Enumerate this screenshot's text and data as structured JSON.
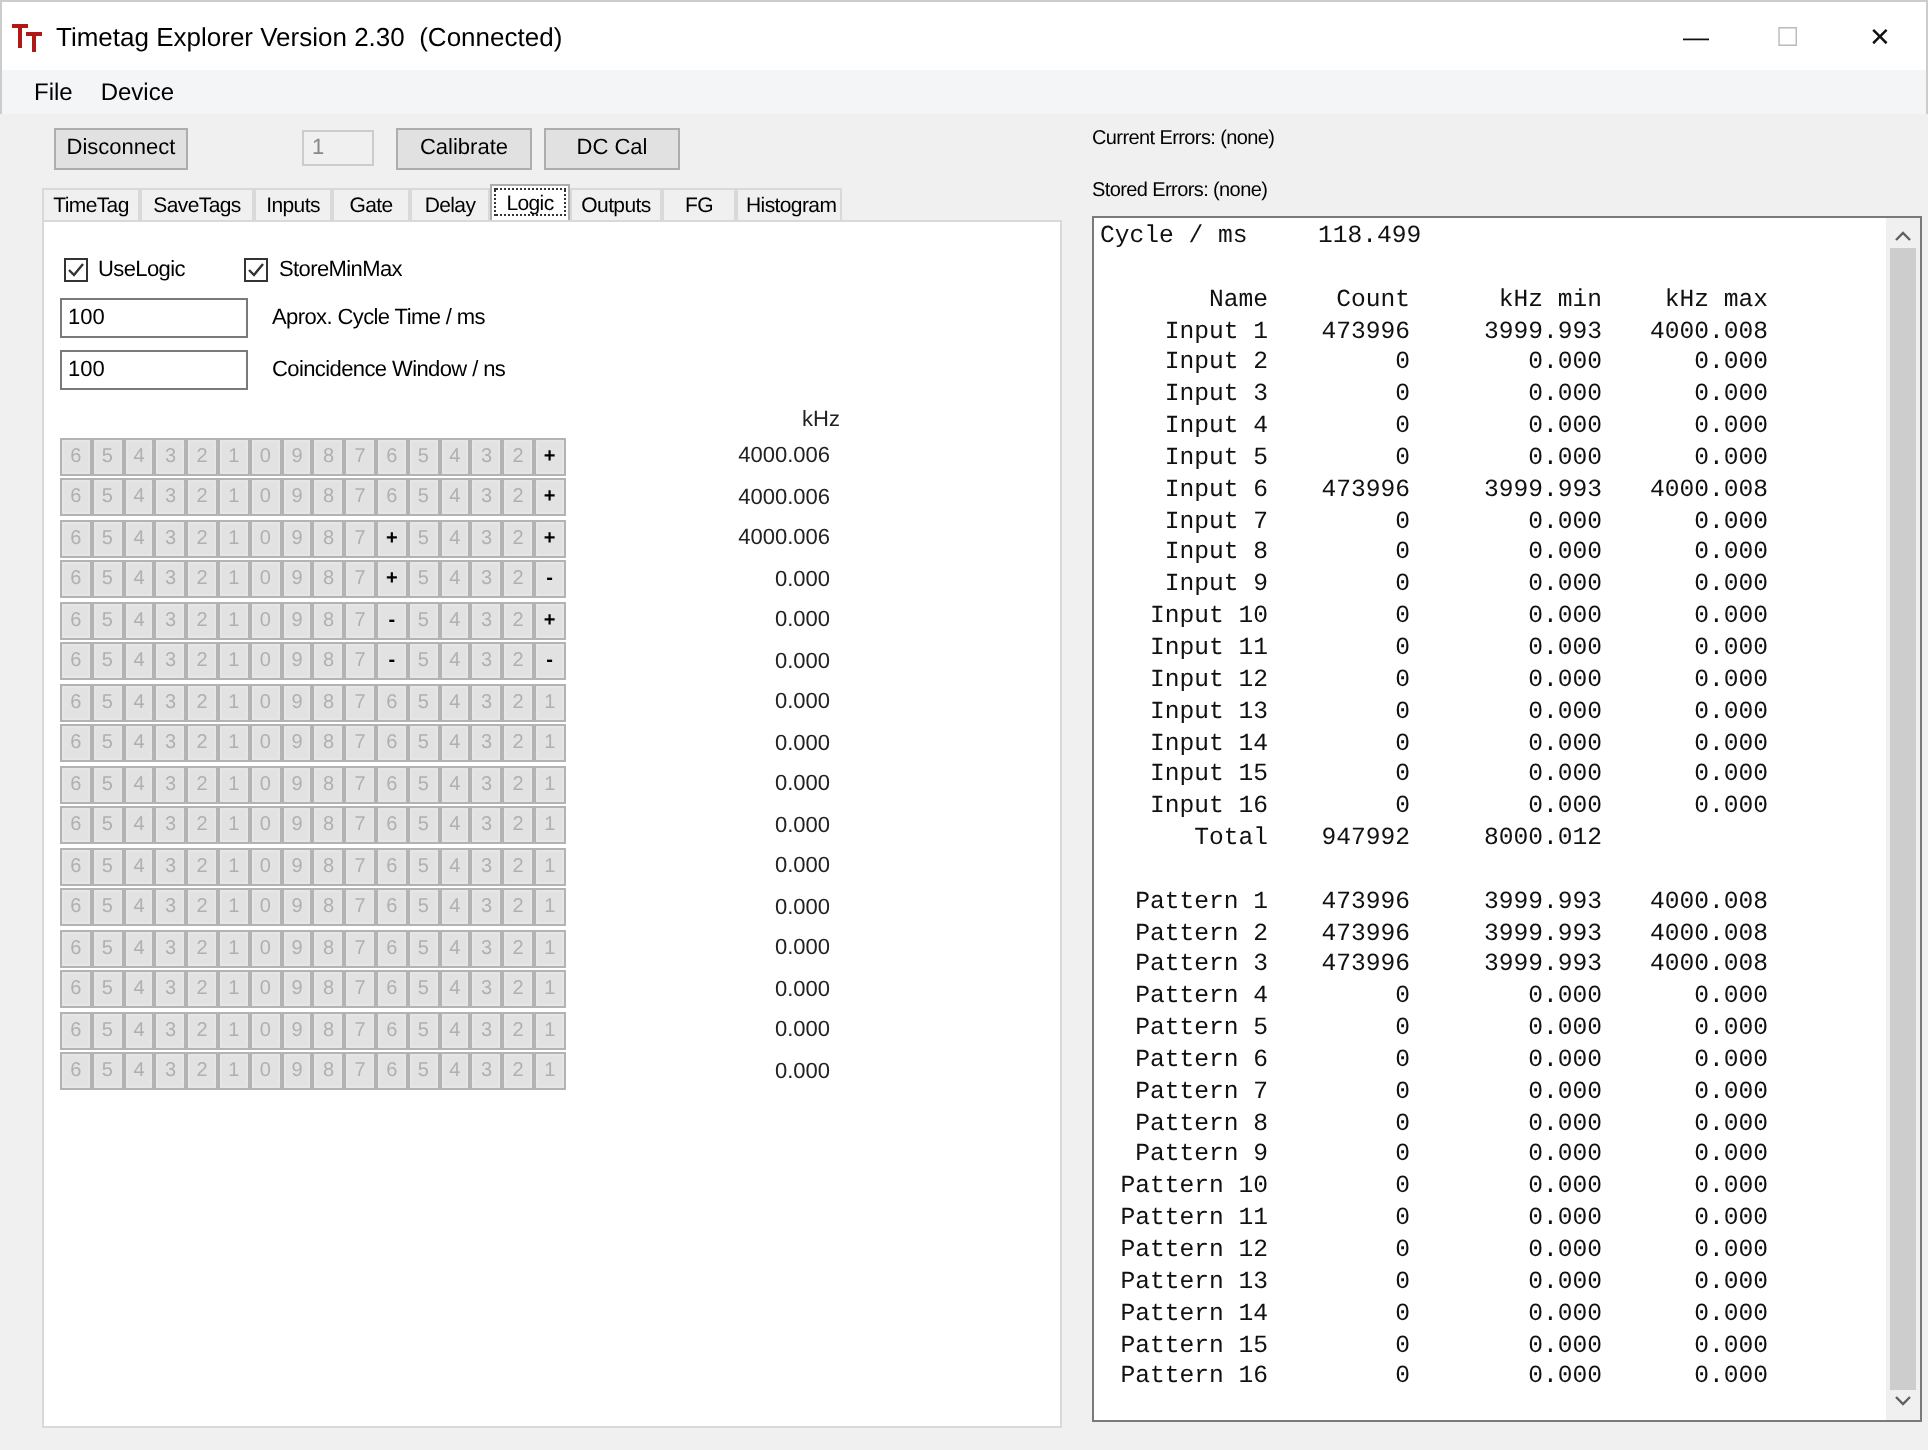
{
  "window": {
    "title": "Timetag Explorer Version 2.30  (Connected)",
    "controls": [
      {
        "symbol": "—",
        "disabled": false
      },
      {
        "symbol": "☐",
        "disabled": true
      },
      {
        "symbol": "✕",
        "disabled": false
      }
    ]
  },
  "menu": [
    "File",
    "Device"
  ],
  "toolbar": {
    "disconnect": "Disconnect",
    "channel": {
      "value": "1",
      "disabled": true
    },
    "calibrate": "Calibrate",
    "dc_cal": "DC Cal"
  },
  "tabs": [
    {
      "label": "TimeTag",
      "selected": false
    },
    {
      "label": "SaveTags",
      "selected": false
    },
    {
      "label": "Inputs",
      "selected": false
    },
    {
      "label": "Gate",
      "selected": false
    },
    {
      "label": "Delay",
      "selected": false
    },
    {
      "label": "Logic",
      "selected": true
    },
    {
      "label": "Outputs",
      "selected": false
    },
    {
      "label": "FG",
      "selected": false
    },
    {
      "label": "Histogram",
      "selected": false
    }
  ],
  "logic": {
    "checkboxes": [
      {
        "label": "UseLogic",
        "checked": true
      },
      {
        "label": "StoreMinMax",
        "checked": true
      }
    ],
    "fields": [
      {
        "value": "100",
        "label": "Aprox. Cycle Time / ms"
      },
      {
        "value": "100",
        "label": "Coincidence Window / ns"
      }
    ],
    "rate_header": "kHz",
    "rows": [
      {
        "rate": "4000.006",
        "cells": [
          {
            "label": "6",
            "enabled": false
          },
          {
            "label": "5",
            "enabled": false
          },
          {
            "label": "4",
            "enabled": false
          },
          {
            "label": "3",
            "enabled": false
          },
          {
            "label": "2",
            "enabled": false
          },
          {
            "label": "1",
            "enabled": false
          },
          {
            "label": "0",
            "enabled": false
          },
          {
            "label": "9",
            "enabled": false
          },
          {
            "label": "8",
            "enabled": false
          },
          {
            "label": "7",
            "enabled": false
          },
          {
            "label": "6",
            "enabled": false
          },
          {
            "label": "5",
            "enabled": false
          },
          {
            "label": "4",
            "enabled": false
          },
          {
            "label": "3",
            "enabled": false
          },
          {
            "label": "2",
            "enabled": false
          },
          {
            "label": "+",
            "enabled": true
          }
        ]
      },
      {
        "rate": "4000.006",
        "cells": [
          {
            "label": "6",
            "enabled": false
          },
          {
            "label": "5",
            "enabled": false
          },
          {
            "label": "4",
            "enabled": false
          },
          {
            "label": "3",
            "enabled": false
          },
          {
            "label": "2",
            "enabled": false
          },
          {
            "label": "1",
            "enabled": false
          },
          {
            "label": "0",
            "enabled": false
          },
          {
            "label": "9",
            "enabled": false
          },
          {
            "label": "8",
            "enabled": false
          },
          {
            "label": "7",
            "enabled": false
          },
          {
            "label": "6",
            "enabled": false
          },
          {
            "label": "5",
            "enabled": false
          },
          {
            "label": "4",
            "enabled": false
          },
          {
            "label": "3",
            "enabled": false
          },
          {
            "label": "2",
            "enabled": false
          },
          {
            "label": "+",
            "enabled": true
          }
        ]
      },
      {
        "rate": "4000.006",
        "cells": [
          {
            "label": "6",
            "enabled": false
          },
          {
            "label": "5",
            "enabled": false
          },
          {
            "label": "4",
            "enabled": false
          },
          {
            "label": "3",
            "enabled": false
          },
          {
            "label": "2",
            "enabled": false
          },
          {
            "label": "1",
            "enabled": false
          },
          {
            "label": "0",
            "enabled": false
          },
          {
            "label": "9",
            "enabled": false
          },
          {
            "label": "8",
            "enabled": false
          },
          {
            "label": "7",
            "enabled": false
          },
          {
            "label": "+",
            "enabled": true
          },
          {
            "label": "5",
            "enabled": false
          },
          {
            "label": "4",
            "enabled": false
          },
          {
            "label": "3",
            "enabled": false
          },
          {
            "label": "2",
            "enabled": false
          },
          {
            "label": "+",
            "enabled": true
          }
        ]
      },
      {
        "rate": "0.000",
        "cells": [
          {
            "label": "6",
            "enabled": false
          },
          {
            "label": "5",
            "enabled": false
          },
          {
            "label": "4",
            "enabled": false
          },
          {
            "label": "3",
            "enabled": false
          },
          {
            "label": "2",
            "enabled": false
          },
          {
            "label": "1",
            "enabled": false
          },
          {
            "label": "0",
            "enabled": false
          },
          {
            "label": "9",
            "enabled": false
          },
          {
            "label": "8",
            "enabled": false
          },
          {
            "label": "7",
            "enabled": false
          },
          {
            "label": "+",
            "enabled": true
          },
          {
            "label": "5",
            "enabled": false
          },
          {
            "label": "4",
            "enabled": false
          },
          {
            "label": "3",
            "enabled": false
          },
          {
            "label": "2",
            "enabled": false
          },
          {
            "label": "-",
            "enabled": true
          }
        ]
      },
      {
        "rate": "0.000",
        "cells": [
          {
            "label": "6",
            "enabled": false
          },
          {
            "label": "5",
            "enabled": false
          },
          {
            "label": "4",
            "enabled": false
          },
          {
            "label": "3",
            "enabled": false
          },
          {
            "label": "2",
            "enabled": false
          },
          {
            "label": "1",
            "enabled": false
          },
          {
            "label": "0",
            "enabled": false
          },
          {
            "label": "9",
            "enabled": false
          },
          {
            "label": "8",
            "enabled": false
          },
          {
            "label": "7",
            "enabled": false
          },
          {
            "label": "-",
            "enabled": true
          },
          {
            "label": "5",
            "enabled": false
          },
          {
            "label": "4",
            "enabled": false
          },
          {
            "label": "3",
            "enabled": false
          },
          {
            "label": "2",
            "enabled": false
          },
          {
            "label": "+",
            "enabled": true
          }
        ]
      },
      {
        "rate": "0.000",
        "cells": [
          {
            "label": "6",
            "enabled": false
          },
          {
            "label": "5",
            "enabled": false
          },
          {
            "label": "4",
            "enabled": false
          },
          {
            "label": "3",
            "enabled": false
          },
          {
            "label": "2",
            "enabled": false
          },
          {
            "label": "1",
            "enabled": false
          },
          {
            "label": "0",
            "enabled": false
          },
          {
            "label": "9",
            "enabled": false
          },
          {
            "label": "8",
            "enabled": false
          },
          {
            "label": "7",
            "enabled": false
          },
          {
            "label": "-",
            "enabled": true
          },
          {
            "label": "5",
            "enabled": false
          },
          {
            "label": "4",
            "enabled": false
          },
          {
            "label": "3",
            "enabled": false
          },
          {
            "label": "2",
            "enabled": false
          },
          {
            "label": "-",
            "enabled": true
          }
        ]
      },
      {
        "rate": "0.000",
        "cells": [
          {
            "label": "6",
            "enabled": false
          },
          {
            "label": "5",
            "enabled": false
          },
          {
            "label": "4",
            "enabled": false
          },
          {
            "label": "3",
            "enabled": false
          },
          {
            "label": "2",
            "enabled": false
          },
          {
            "label": "1",
            "enabled": false
          },
          {
            "label": "0",
            "enabled": false
          },
          {
            "label": "9",
            "enabled": false
          },
          {
            "label": "8",
            "enabled": false
          },
          {
            "label": "7",
            "enabled": false
          },
          {
            "label": "6",
            "enabled": false
          },
          {
            "label": "5",
            "enabled": false
          },
          {
            "label": "4",
            "enabled": false
          },
          {
            "label": "3",
            "enabled": false
          },
          {
            "label": "2",
            "enabled": false
          },
          {
            "label": "1",
            "enabled": false
          }
        ]
      },
      {
        "rate": "0.000",
        "cells": [
          {
            "label": "6",
            "enabled": false
          },
          {
            "label": "5",
            "enabled": false
          },
          {
            "label": "4",
            "enabled": false
          },
          {
            "label": "3",
            "enabled": false
          },
          {
            "label": "2",
            "enabled": false
          },
          {
            "label": "1",
            "enabled": false
          },
          {
            "label": "0",
            "enabled": false
          },
          {
            "label": "9",
            "enabled": false
          },
          {
            "label": "8",
            "enabled": false
          },
          {
            "label": "7",
            "enabled": false
          },
          {
            "label": "6",
            "enabled": false
          },
          {
            "label": "5",
            "enabled": false
          },
          {
            "label": "4",
            "enabled": false
          },
          {
            "label": "3",
            "enabled": false
          },
          {
            "label": "2",
            "enabled": false
          },
          {
            "label": "1",
            "enabled": false
          }
        ]
      },
      {
        "rate": "0.000",
        "cells": [
          {
            "label": "6",
            "enabled": false
          },
          {
            "label": "5",
            "enabled": false
          },
          {
            "label": "4",
            "enabled": false
          },
          {
            "label": "3",
            "enabled": false
          },
          {
            "label": "2",
            "enabled": false
          },
          {
            "label": "1",
            "enabled": false
          },
          {
            "label": "0",
            "enabled": false
          },
          {
            "label": "9",
            "enabled": false
          },
          {
            "label": "8",
            "enabled": false
          },
          {
            "label": "7",
            "enabled": false
          },
          {
            "label": "6",
            "enabled": false
          },
          {
            "label": "5",
            "enabled": false
          },
          {
            "label": "4",
            "enabled": false
          },
          {
            "label": "3",
            "enabled": false
          },
          {
            "label": "2",
            "enabled": false
          },
          {
            "label": "1",
            "enabled": false
          }
        ]
      },
      {
        "rate": "0.000",
        "cells": [
          {
            "label": "6",
            "enabled": false
          },
          {
            "label": "5",
            "enabled": false
          },
          {
            "label": "4",
            "enabled": false
          },
          {
            "label": "3",
            "enabled": false
          },
          {
            "label": "2",
            "enabled": false
          },
          {
            "label": "1",
            "enabled": false
          },
          {
            "label": "0",
            "enabled": false
          },
          {
            "label": "9",
            "enabled": false
          },
          {
            "label": "8",
            "enabled": false
          },
          {
            "label": "7",
            "enabled": false
          },
          {
            "label": "6",
            "enabled": false
          },
          {
            "label": "5",
            "enabled": false
          },
          {
            "label": "4",
            "enabled": false
          },
          {
            "label": "3",
            "enabled": false
          },
          {
            "label": "2",
            "enabled": false
          },
          {
            "label": "1",
            "enabled": false
          }
        ]
      },
      {
        "rate": "0.000",
        "cells": [
          {
            "label": "6",
            "enabled": false
          },
          {
            "label": "5",
            "enabled": false
          },
          {
            "label": "4",
            "enabled": false
          },
          {
            "label": "3",
            "enabled": false
          },
          {
            "label": "2",
            "enabled": false
          },
          {
            "label": "1",
            "enabled": false
          },
          {
            "label": "0",
            "enabled": false
          },
          {
            "label": "9",
            "enabled": false
          },
          {
            "label": "8",
            "enabled": false
          },
          {
            "label": "7",
            "enabled": false
          },
          {
            "label": "6",
            "enabled": false
          },
          {
            "label": "5",
            "enabled": false
          },
          {
            "label": "4",
            "enabled": false
          },
          {
            "label": "3",
            "enabled": false
          },
          {
            "label": "2",
            "enabled": false
          },
          {
            "label": "1",
            "enabled": false
          }
        ]
      },
      {
        "rate": "0.000",
        "cells": [
          {
            "label": "6",
            "enabled": false
          },
          {
            "label": "5",
            "enabled": false
          },
          {
            "label": "4",
            "enabled": false
          },
          {
            "label": "3",
            "enabled": false
          },
          {
            "label": "2",
            "enabled": false
          },
          {
            "label": "1",
            "enabled": false
          },
          {
            "label": "0",
            "enabled": false
          },
          {
            "label": "9",
            "enabled": false
          },
          {
            "label": "8",
            "enabled": false
          },
          {
            "label": "7",
            "enabled": false
          },
          {
            "label": "6",
            "enabled": false
          },
          {
            "label": "5",
            "enabled": false
          },
          {
            "label": "4",
            "enabled": false
          },
          {
            "label": "3",
            "enabled": false
          },
          {
            "label": "2",
            "enabled": false
          },
          {
            "label": "1",
            "enabled": false
          }
        ]
      },
      {
        "rate": "0.000",
        "cells": [
          {
            "label": "6",
            "enabled": false
          },
          {
            "label": "5",
            "enabled": false
          },
          {
            "label": "4",
            "enabled": false
          },
          {
            "label": "3",
            "enabled": false
          },
          {
            "label": "2",
            "enabled": false
          },
          {
            "label": "1",
            "enabled": false
          },
          {
            "label": "0",
            "enabled": false
          },
          {
            "label": "9",
            "enabled": false
          },
          {
            "label": "8",
            "enabled": false
          },
          {
            "label": "7",
            "enabled": false
          },
          {
            "label": "6",
            "enabled": false
          },
          {
            "label": "5",
            "enabled": false
          },
          {
            "label": "4",
            "enabled": false
          },
          {
            "label": "3",
            "enabled": false
          },
          {
            "label": "2",
            "enabled": false
          },
          {
            "label": "1",
            "enabled": false
          }
        ]
      },
      {
        "rate": "0.000",
        "cells": [
          {
            "label": "6",
            "enabled": false
          },
          {
            "label": "5",
            "enabled": false
          },
          {
            "label": "4",
            "enabled": false
          },
          {
            "label": "3",
            "enabled": false
          },
          {
            "label": "2",
            "enabled": false
          },
          {
            "label": "1",
            "enabled": false
          },
          {
            "label": "0",
            "enabled": false
          },
          {
            "label": "9",
            "enabled": false
          },
          {
            "label": "8",
            "enabled": false
          },
          {
            "label": "7",
            "enabled": false
          },
          {
            "label": "6",
            "enabled": false
          },
          {
            "label": "5",
            "enabled": false
          },
          {
            "label": "4",
            "enabled": false
          },
          {
            "label": "3",
            "enabled": false
          },
          {
            "label": "2",
            "enabled": false
          },
          {
            "label": "1",
            "enabled": false
          }
        ]
      },
      {
        "rate": "0.000",
        "cells": [
          {
            "label": "6",
            "enabled": false
          },
          {
            "label": "5",
            "enabled": false
          },
          {
            "label": "4",
            "enabled": false
          },
          {
            "label": "3",
            "enabled": false
          },
          {
            "label": "2",
            "enabled": false
          },
          {
            "label": "1",
            "enabled": false
          },
          {
            "label": "0",
            "enabled": false
          },
          {
            "label": "9",
            "enabled": false
          },
          {
            "label": "8",
            "enabled": false
          },
          {
            "label": "7",
            "enabled": false
          },
          {
            "label": "6",
            "enabled": false
          },
          {
            "label": "5",
            "enabled": false
          },
          {
            "label": "4",
            "enabled": false
          },
          {
            "label": "3",
            "enabled": false
          },
          {
            "label": "2",
            "enabled": false
          },
          {
            "label": "1",
            "enabled": false
          }
        ]
      },
      {
        "rate": "0.000",
        "cells": [
          {
            "label": "6",
            "enabled": false
          },
          {
            "label": "5",
            "enabled": false
          },
          {
            "label": "4",
            "enabled": false
          },
          {
            "label": "3",
            "enabled": false
          },
          {
            "label": "2",
            "enabled": false
          },
          {
            "label": "1",
            "enabled": false
          },
          {
            "label": "0",
            "enabled": false
          },
          {
            "label": "9",
            "enabled": false
          },
          {
            "label": "8",
            "enabled": false
          },
          {
            "label": "7",
            "enabled": false
          },
          {
            "label": "6",
            "enabled": false
          },
          {
            "label": "5",
            "enabled": false
          },
          {
            "label": "4",
            "enabled": false
          },
          {
            "label": "3",
            "enabled": false
          },
          {
            "label": "2",
            "enabled": false
          },
          {
            "label": "1",
            "enabled": false
          }
        ]
      }
    ]
  },
  "status": {
    "current_errors": "Current Errors: (none)",
    "stored_errors": "Stored Errors: (none)"
  },
  "readout": {
    "cycle_label": "Cycle / ms",
    "cycle_value": "118.499",
    "columns": [
      "Name",
      "Count",
      "kHz min",
      "kHz max"
    ],
    "inputs": [
      [
        "Input 1",
        "473996",
        "3999.993",
        "4000.008"
      ],
      [
        "Input 2",
        "0",
        "0.000",
        "0.000"
      ],
      [
        "Input 3",
        "0",
        "0.000",
        "0.000"
      ],
      [
        "Input 4",
        "0",
        "0.000",
        "0.000"
      ],
      [
        "Input 5",
        "0",
        "0.000",
        "0.000"
      ],
      [
        "Input 6",
        "473996",
        "3999.993",
        "4000.008"
      ],
      [
        "Input 7",
        "0",
        "0.000",
        "0.000"
      ],
      [
        "Input 8",
        "0",
        "0.000",
        "0.000"
      ],
      [
        "Input 9",
        "0",
        "0.000",
        "0.000"
      ],
      [
        "Input 10",
        "0",
        "0.000",
        "0.000"
      ],
      [
        "Input 11",
        "0",
        "0.000",
        "0.000"
      ],
      [
        "Input 12",
        "0",
        "0.000",
        "0.000"
      ],
      [
        "Input 13",
        "0",
        "0.000",
        "0.000"
      ],
      [
        "Input 14",
        "0",
        "0.000",
        "0.000"
      ],
      [
        "Input 15",
        "0",
        "0.000",
        "0.000"
      ],
      [
        "Input 16",
        "0",
        "0.000",
        "0.000"
      ],
      [
        "Total",
        "947992",
        "8000.012"
      ]
    ],
    "patterns": [
      [
        "Pattern 1",
        "473996",
        "3999.993",
        "4000.008"
      ],
      [
        "Pattern 2",
        "473996",
        "3999.993",
        "4000.008"
      ],
      [
        "Pattern 3",
        "473996",
        "3999.993",
        "4000.008"
      ],
      [
        "Pattern 4",
        "0",
        "0.000",
        "0.000"
      ],
      [
        "Pattern 5",
        "0",
        "0.000",
        "0.000"
      ],
      [
        "Pattern 6",
        "0",
        "0.000",
        "0.000"
      ],
      [
        "Pattern 7",
        "0",
        "0.000",
        "0.000"
      ],
      [
        "Pattern 8",
        "0",
        "0.000",
        "0.000"
      ],
      [
        "Pattern 9",
        "0",
        "0.000",
        "0.000"
      ],
      [
        "Pattern 10",
        "0",
        "0.000",
        "0.000"
      ],
      [
        "Pattern 11",
        "0",
        "0.000",
        "0.000"
      ],
      [
        "Pattern 12",
        "0",
        "0.000",
        "0.000"
      ],
      [
        "Pattern 13",
        "0",
        "0.000",
        "0.000"
      ],
      [
        "Pattern 14",
        "0",
        "0.000",
        "0.000"
      ],
      [
        "Pattern 15",
        "0",
        "0.000",
        "0.000"
      ],
      [
        "Pattern 16",
        "0",
        "0.000",
        "0.000"
      ]
    ]
  }
}
